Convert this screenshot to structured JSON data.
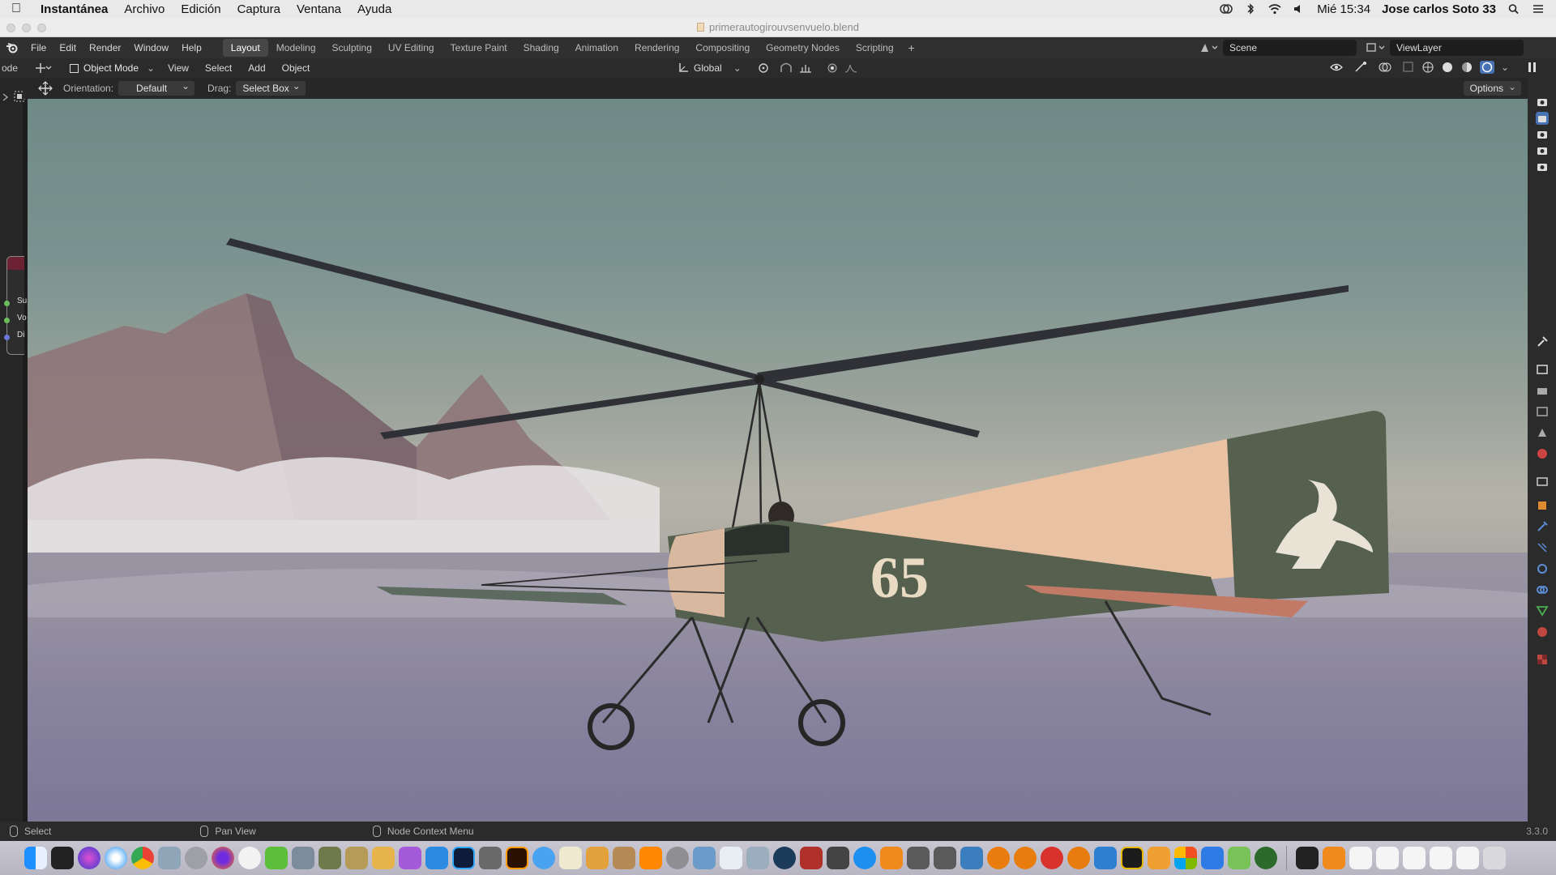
{
  "macos": {
    "app_name": "Instantánea",
    "menus": [
      "Archivo",
      "Edición",
      "Captura",
      "Ventana",
      "Ayuda"
    ],
    "clock": "Mié 15:34",
    "user": "Jose carlos Soto 33"
  },
  "window": {
    "title": "primerautogirouvsenvuelo.blend"
  },
  "blender": {
    "menus": [
      "File",
      "Edit",
      "Render",
      "Window",
      "Help"
    ],
    "workspaces": [
      "Layout",
      "Modeling",
      "Sculpting",
      "UV Editing",
      "Texture Paint",
      "Shading",
      "Animation",
      "Rendering",
      "Compositing",
      "Geometry Nodes",
      "Scripting"
    ],
    "active_workspace": "Layout",
    "scene": "Scene",
    "view_layer": "ViewLayer"
  },
  "viewport_header": {
    "left_label": "ode",
    "mode": "Object Mode",
    "menus": [
      "View",
      "Select",
      "Add",
      "Object"
    ],
    "transform_orientation": "Global"
  },
  "tool_header": {
    "orientation_label": "Orientation:",
    "orientation_value": "Default",
    "drag_label": "Drag:",
    "drag_value": "Select Box",
    "options_label": "Options"
  },
  "node_panel": {
    "sockets": [
      "Su",
      "Vo",
      "Di"
    ]
  },
  "scene_content": {
    "plane_number": "65"
  },
  "status_bar": {
    "select": "Select",
    "pan_view": "Pan View",
    "context_menu": "Node Context Menu",
    "version": "3.3.0"
  },
  "colors": {
    "active_tab": "#474747",
    "plane_green": "#55604f",
    "rotor": "#2f3136"
  }
}
